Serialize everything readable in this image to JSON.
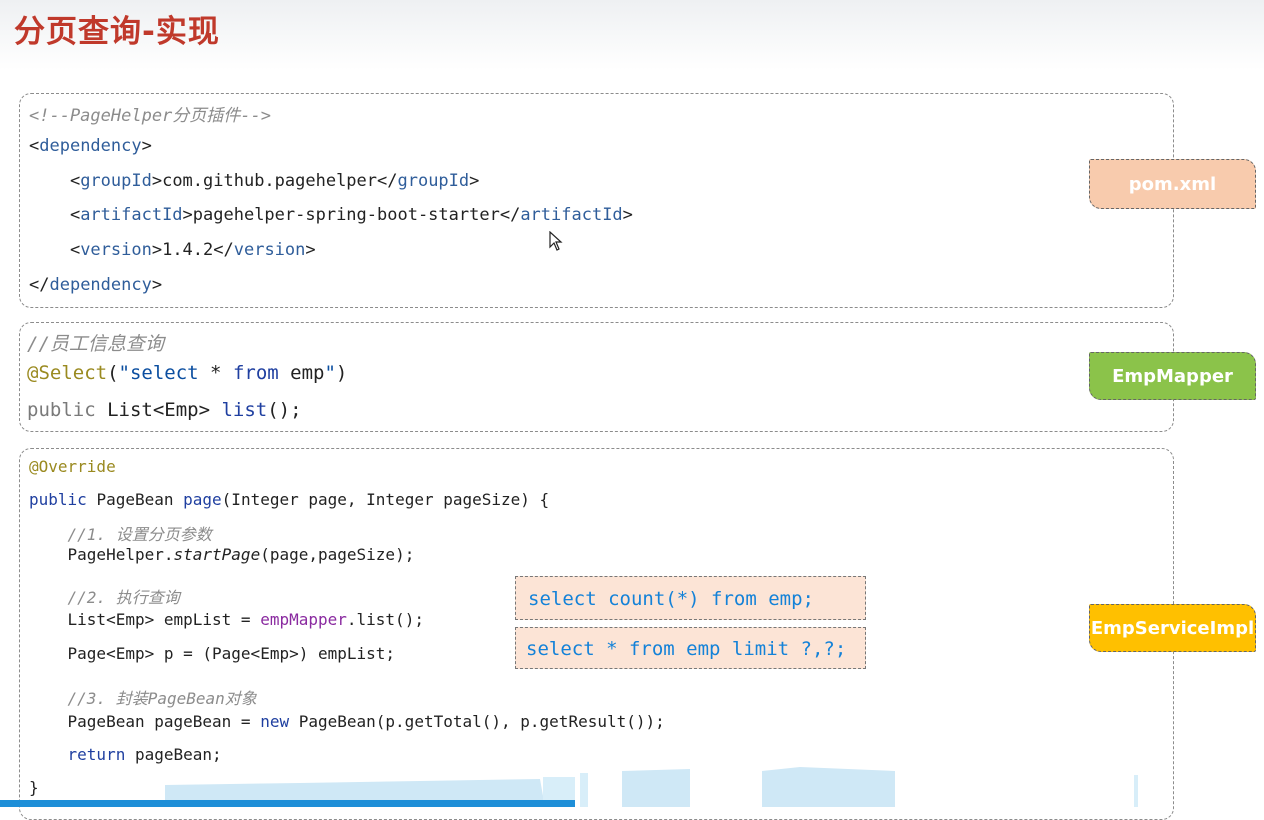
{
  "title": "分页查询-实现",
  "pom": {
    "lines": [
      {
        "parts": [
          [
            "c-comment",
            "<!--PageHelper分页插件-->"
          ]
        ]
      },
      {
        "parts": [
          [
            "c-plain",
            "<"
          ],
          [
            "c-tag",
            "dependency"
          ],
          [
            "c-plain",
            ">"
          ]
        ]
      },
      {
        "parts": [
          [
            "c-plain",
            "    <"
          ],
          [
            "c-tag",
            "groupId"
          ],
          [
            "c-plain",
            ">com.github.pagehelper</"
          ],
          [
            "c-tag",
            "groupId"
          ],
          [
            "c-plain",
            ">"
          ]
        ]
      },
      {
        "parts": [
          [
            "c-plain",
            "    <"
          ],
          [
            "c-tag",
            "artifactId"
          ],
          [
            "c-plain",
            ">pagehelper-spring-boot-starter</"
          ],
          [
            "c-tag",
            "artifactId"
          ],
          [
            "c-plain",
            ">"
          ]
        ]
      },
      {
        "parts": [
          [
            "c-plain",
            "    <"
          ],
          [
            "c-tag",
            "version"
          ],
          [
            "c-plain",
            ">1.4.2</"
          ],
          [
            "c-tag",
            "version"
          ],
          [
            "c-plain",
            ">"
          ]
        ]
      },
      {
        "parts": [
          [
            "c-plain",
            "</"
          ],
          [
            "c-tag",
            "dependency"
          ],
          [
            "c-plain",
            ">"
          ]
        ]
      }
    ],
    "tag_label": "pom.xml",
    "tag_color": "#f8cbad"
  },
  "mapper": {
    "lines": [
      {
        "parts": [
          [
            "c-comment",
            "//员工信息查询"
          ]
        ]
      },
      {
        "parts": [
          [
            "c-ann",
            "@Select"
          ],
          [
            "c-plain",
            "("
          ],
          [
            "c-str",
            "\"select "
          ],
          [
            "c-plain",
            "* "
          ],
          [
            "c-kw",
            "from "
          ],
          [
            "c-plain",
            "emp"
          ],
          [
            "c-str",
            "\""
          ],
          [
            "c-plain",
            ")"
          ]
        ]
      },
      {
        "parts": [
          [
            "c-gray",
            "public "
          ],
          [
            "c-plain",
            "List<Emp> "
          ],
          [
            "c-kw",
            "list"
          ],
          [
            "c-plain",
            "();"
          ]
        ]
      }
    ],
    "tag_label": "EmpMapper",
    "tag_color": "#8bc34a"
  },
  "service": {
    "lines": [
      {
        "parts": [
          [
            "c-ann",
            "@Override"
          ]
        ]
      },
      {
        "parts": [
          [
            "c-kw",
            "public "
          ],
          [
            "c-plain",
            "PageBean "
          ],
          [
            "c-kw",
            "page"
          ],
          [
            "c-plain",
            "(Integer page, Integer pageSize) {"
          ]
        ]
      },
      {
        "parts": [
          [
            "c-comment",
            "    //1. 设置分页参数"
          ]
        ]
      },
      {
        "parts": [
          [
            "c-plain",
            "    PageHelper."
          ],
          [
            "c-comment-plain",
            "startPage"
          ],
          [
            "c-plain",
            "(page,pageSize);"
          ]
        ]
      },
      {
        "parts": [
          [
            "c-comment",
            "    //2. 执行查询"
          ]
        ]
      },
      {
        "parts": [
          [
            "c-plain",
            "    List<Emp> empList = "
          ],
          [
            "c-field",
            "empMapper"
          ],
          [
            "c-plain",
            ".list();"
          ]
        ]
      },
      {
        "parts": [
          [
            "c-plain",
            "    Page<Emp> p = (Page<Emp>) empList;"
          ]
        ]
      },
      {
        "parts": [
          [
            "c-comment",
            "    //3. 封装PageBean对象"
          ]
        ]
      },
      {
        "parts": [
          [
            "c-plain",
            "    PageBean pageBean = "
          ],
          [
            "c-kw",
            "new "
          ],
          [
            "c-plain",
            "PageBean(p.getTotal(), p.getResult());"
          ]
        ]
      },
      {
        "parts": [
          [
            "c-kw",
            "    return "
          ],
          [
            "c-plain",
            "pageBean;"
          ]
        ]
      },
      {
        "parts": [
          [
            "c-plain",
            "}"
          ]
        ]
      }
    ],
    "sql_count": "select count(*) from emp;",
    "sql_limit": "select * from emp limit ?,?;",
    "tag_label": "EmpServiceImpl",
    "tag_color": "#ffc000"
  }
}
